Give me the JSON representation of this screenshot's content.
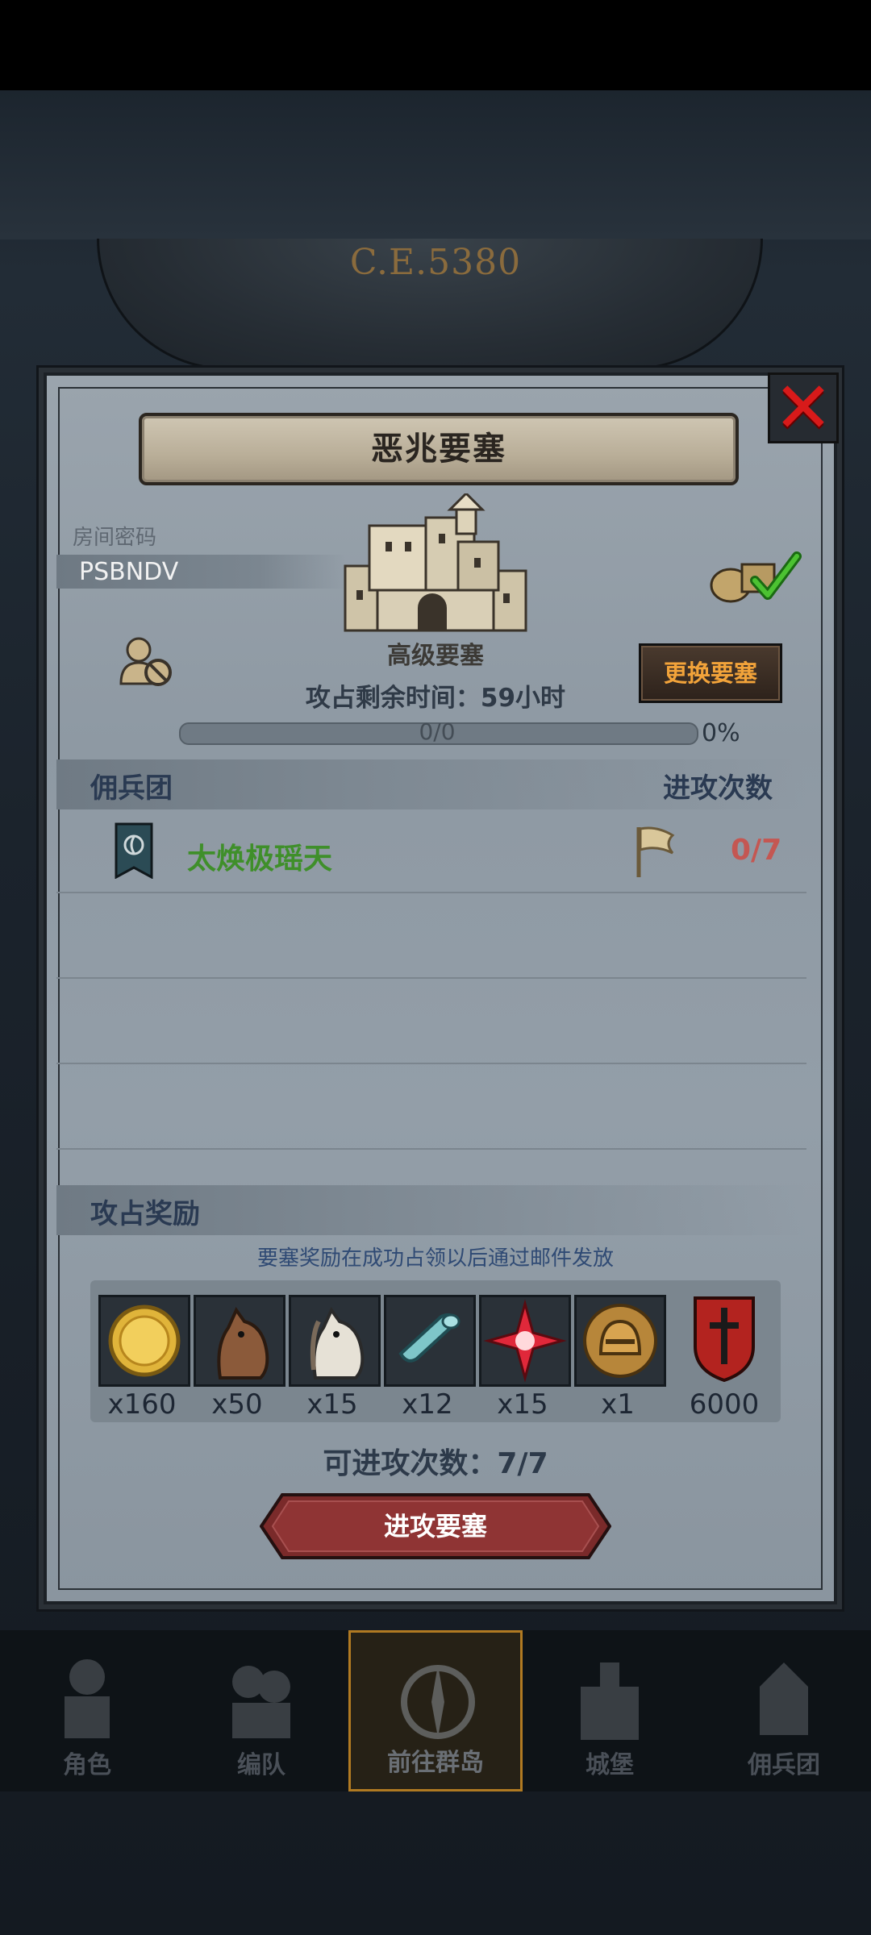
{
  "header": {
    "era": "C.E.5380"
  },
  "dialog": {
    "title": "恶兆要塞",
    "room_password_label": "房间密码",
    "room_password_value": "PSBNDV",
    "fortress_level": "高级要塞",
    "change_fortress_button": "更换要塞",
    "remaining_time": "攻占剩余时间：59小时",
    "progress": {
      "label": "0/0",
      "percent_label": "0%",
      "fraction": 0
    },
    "mercenary_header": "佣兵团",
    "attack_count_header": "进攻次数",
    "guild_name": "太焕极瑶天",
    "guild_attacks": "0/7",
    "rewards_header": "攻占奖励",
    "rewards_notice": "要塞奖励在成功占领以后通过邮件发放",
    "rewards": [
      {
        "icon": "gold-coin-icon",
        "qty": "x160"
      },
      {
        "icon": "brown-horse-icon",
        "qty": "x50"
      },
      {
        "icon": "white-horse-icon",
        "qty": "x15"
      },
      {
        "icon": "cloth-roll-icon",
        "qty": "x12"
      },
      {
        "icon": "red-star-icon",
        "qty": "x15"
      },
      {
        "icon": "knight-helmet-icon",
        "qty": "x1"
      },
      {
        "icon": "sword-shield-icon",
        "qty": "6000"
      }
    ],
    "attacks_available": "可进攻次数：7/7",
    "attack_button": "进攻要塞"
  },
  "bottom_nav": [
    {
      "label": "角色",
      "icon": "knight-icon",
      "active": false
    },
    {
      "label": "编队",
      "icon": "formation-icon",
      "active": false
    },
    {
      "label": "前往群岛",
      "icon": "compass-icon",
      "active": true
    },
    {
      "label": "城堡",
      "icon": "castle-icon",
      "active": false
    },
    {
      "label": "佣兵团",
      "icon": "mercenary-icon",
      "active": false
    }
  ],
  "colors": {
    "accent_orange": "#f2a33a",
    "guild_green": "#3f8f2a",
    "count_red": "#c45752",
    "close_red": "#d81a1a"
  }
}
